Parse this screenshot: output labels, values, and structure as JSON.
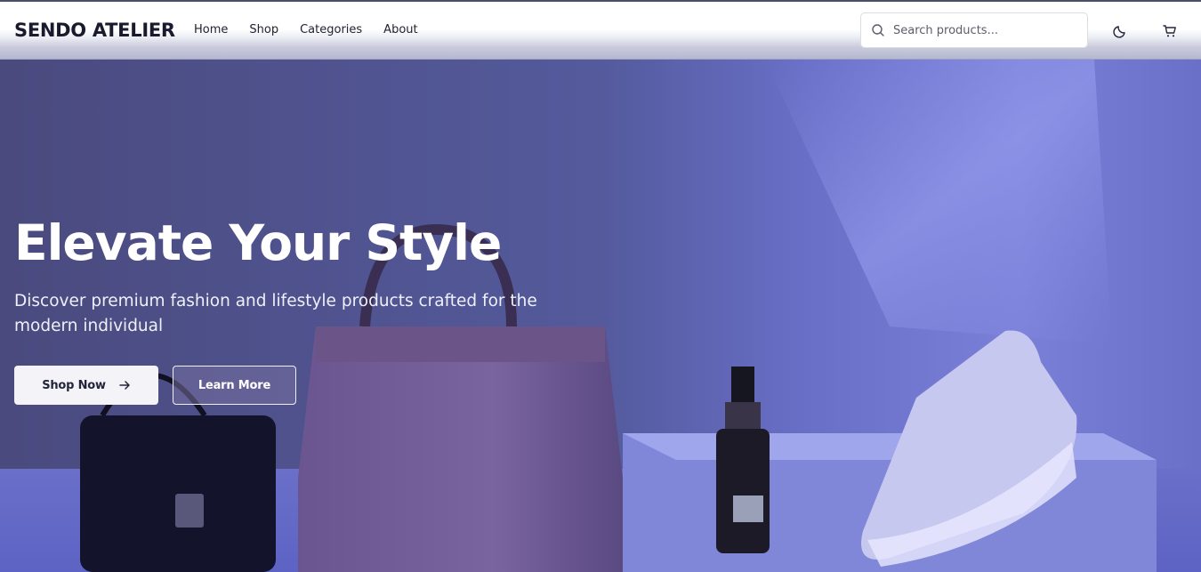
{
  "header": {
    "logo": "SENDO ATELIER",
    "nav": [
      {
        "label": "Home"
      },
      {
        "label": "Shop"
      },
      {
        "label": "Categories"
      },
      {
        "label": "About"
      }
    ],
    "search": {
      "placeholder": "Search products...",
      "value": "",
      "icon": "search-icon"
    },
    "actions": [
      {
        "icon": "moon-icon",
        "name": "theme-toggle"
      },
      {
        "icon": "cart-icon",
        "name": "cart"
      }
    ]
  },
  "hero": {
    "title": "Elevate Your Style",
    "subtitle": "Discover premium fashion and lifestyle products crafted for the modern individual",
    "primary_button": {
      "label": "Shop Now",
      "icon": "arrow-right-icon"
    },
    "secondary_button": {
      "label": "Learn More"
    },
    "image": "products-background"
  },
  "colors": {
    "hero_overlay": "#5b5fc7",
    "text_dark": "#1a1a2e",
    "button_light": "#f4f4f8"
  }
}
